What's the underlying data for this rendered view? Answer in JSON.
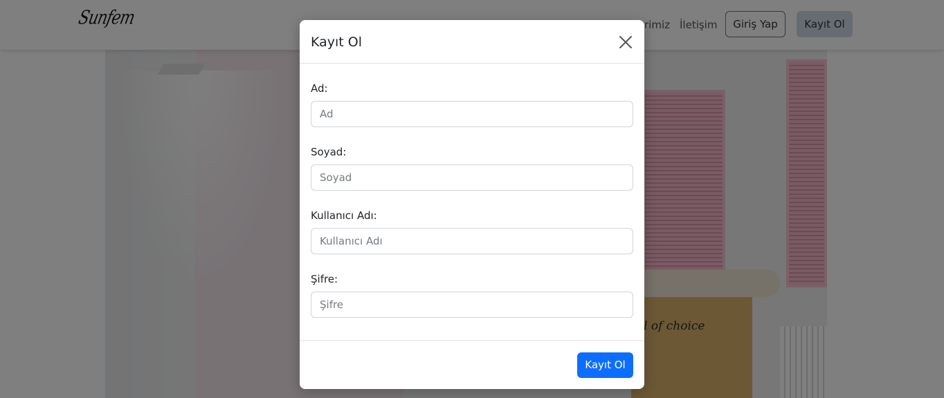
{
  "navbar": {
    "brand": "Sunfem",
    "partial_link": "rimiz",
    "contact_link": "İletişim",
    "login_button": "Giriş Yap",
    "register_button": "Kayıt Ol"
  },
  "hero": {
    "bed_text": "l of choice"
  },
  "modal": {
    "title": "Kayıt Ol",
    "fields": [
      {
        "label": "Ad:",
        "placeholder": "Ad",
        "value": ""
      },
      {
        "label": "Soyad:",
        "placeholder": "Soyad",
        "value": ""
      },
      {
        "label": "Kullanıcı Adı:",
        "placeholder": "Kullanıcı Adı",
        "value": ""
      },
      {
        "label": "Şifre:",
        "placeholder": "Şifre",
        "value": ""
      }
    ],
    "submit_label": "Kayıt Ol",
    "close_icon": "close-icon"
  },
  "colors": {
    "primary": "#0d6efd",
    "backdrop": "rgba(0,0,0,0.5)",
    "nav_register_bg": "#cdd8e5"
  }
}
